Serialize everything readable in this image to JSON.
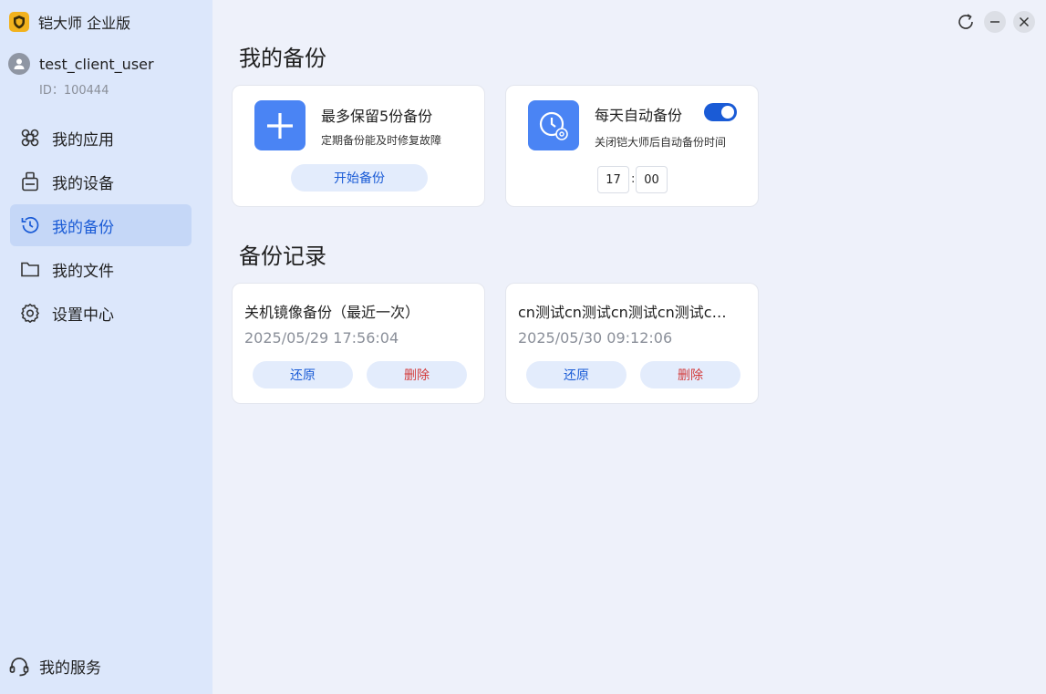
{
  "app": {
    "title": "铠大师 企业版"
  },
  "user": {
    "name": "test_client_user",
    "id": "ID：100444"
  },
  "nav": {
    "items": [
      {
        "label": "我的应用"
      },
      {
        "label": "我的设备"
      },
      {
        "label": "我的备份"
      },
      {
        "label": "我的文件"
      },
      {
        "label": "设置中心"
      }
    ],
    "active_index": 2
  },
  "service": {
    "label": "我的服务"
  },
  "backup": {
    "section_title": "我的备份",
    "manual": {
      "title": "最多保留5份备份",
      "subtitle": "定期备份能及时修复故障",
      "button": "开始备份"
    },
    "auto": {
      "title": "每天自动备份",
      "subtitle": "关闭铠大师后自动备份时间",
      "enabled": true,
      "hour": "17",
      "minute": "00",
      "separator": ":"
    }
  },
  "records": {
    "section_title": "备份记录",
    "items": [
      {
        "title": "关机镜像备份（最近一次）",
        "time": "2025/05/29 17:56:04",
        "restore": "还原",
        "delete": "删除"
      },
      {
        "title": "cn测试cn测试cn测试cn测试cn测试cn测试",
        "time": "2025/05/30 09:12:06",
        "restore": "还原",
        "delete": "删除"
      }
    ]
  },
  "colors": {
    "accent": "#1a5bd6",
    "tile": "#4a84f4",
    "danger": "#d33a3a",
    "sidebar": "#dce7fb",
    "background": "#eef1fa"
  }
}
